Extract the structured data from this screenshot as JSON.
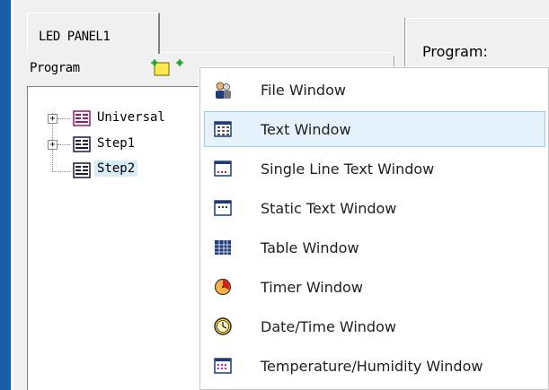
{
  "tab": {
    "label": "LED PANEL1"
  },
  "panel": {
    "program_label": "Program"
  },
  "right_panel": {
    "program_label": "Program:"
  },
  "tree": {
    "items": [
      {
        "label": "Universal",
        "expandable": true,
        "expander": "+"
      },
      {
        "label": "Step1",
        "expandable": true,
        "expander": "+"
      },
      {
        "label": "Step2",
        "expandable": false,
        "selected": true
      }
    ]
  },
  "menu": {
    "items": [
      {
        "label": "File Window",
        "icon": "people-file-icon"
      },
      {
        "label": "Text Window",
        "icon": "text-grid-icon",
        "highlighted": true
      },
      {
        "label": "Single Line Text Window",
        "icon": "single-line-text-icon"
      },
      {
        "label": "Static Text Window",
        "icon": "static-text-icon"
      },
      {
        "label": "Table Window",
        "icon": "table-icon"
      },
      {
        "label": "Timer Window",
        "icon": "timer-icon"
      },
      {
        "label": "Date/Time Window",
        "icon": "clock-icon"
      },
      {
        "label": "Temperature/Humidity Window",
        "icon": "temperature-icon"
      }
    ]
  },
  "colors": {
    "accent_blue": "#1a5ea8",
    "highlight_bg": "#e5f1fb",
    "highlight_border": "#9bc9ec",
    "selection_bg": "#d9ebf7"
  }
}
